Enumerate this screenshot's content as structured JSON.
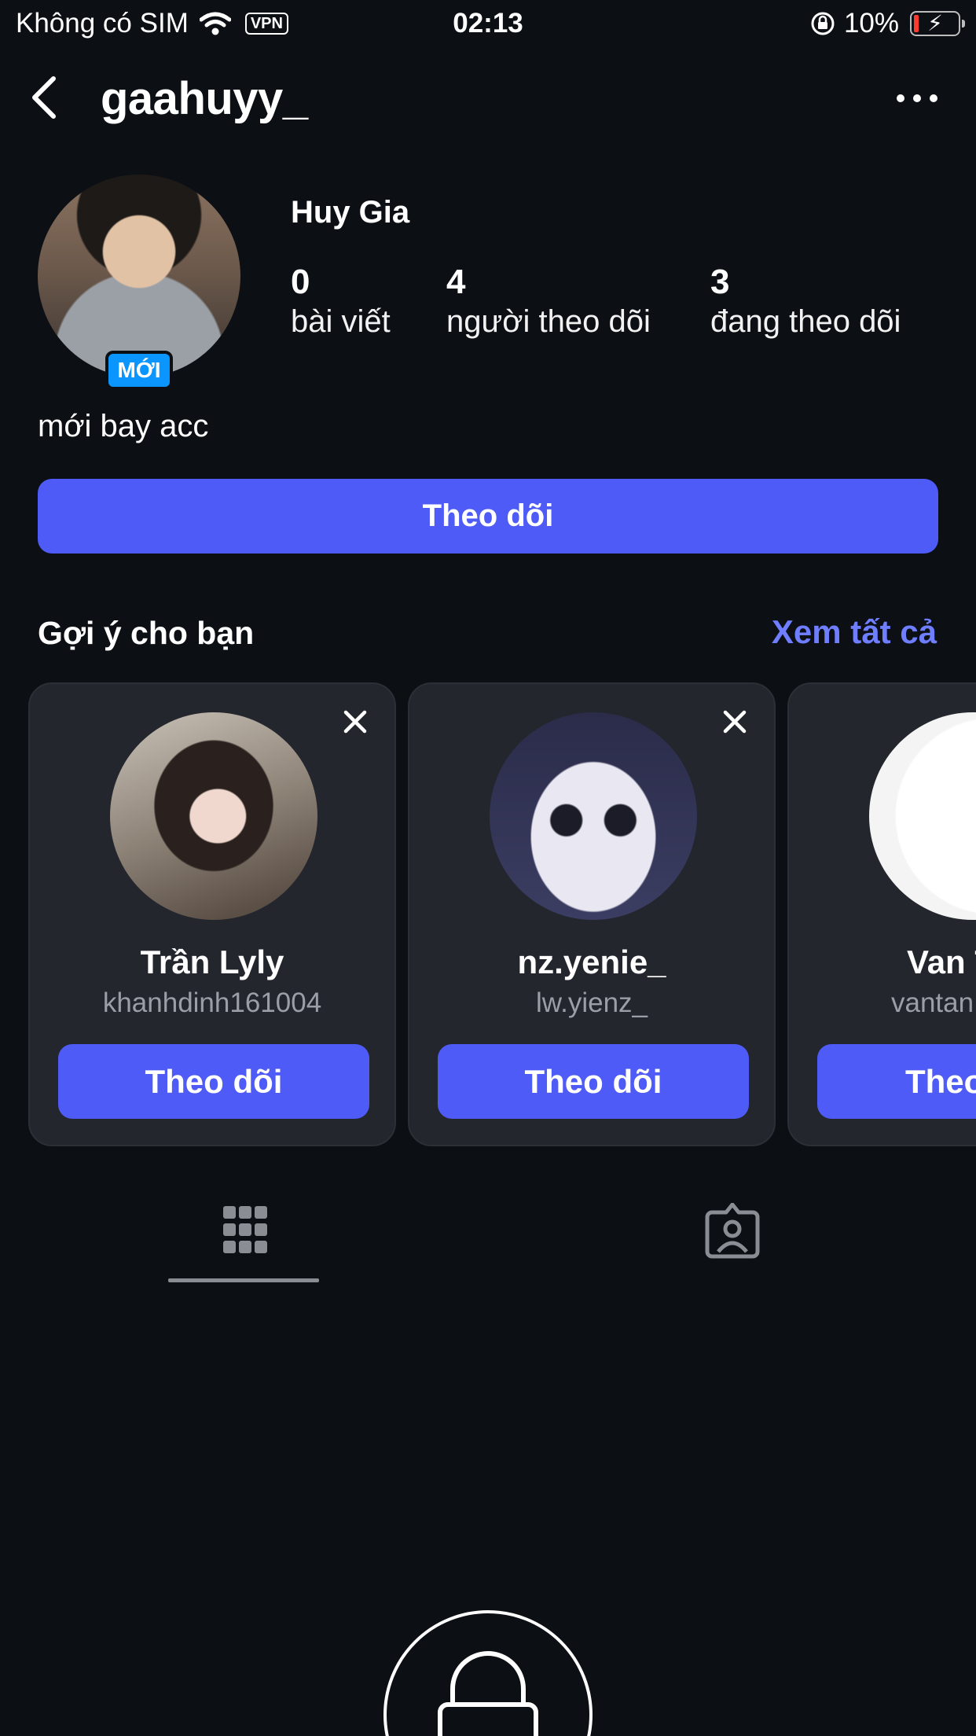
{
  "status_bar": {
    "carrier": "Không có SIM",
    "vpn": "VPN",
    "time": "02:13",
    "battery": "10%",
    "battery_color": "#ff3b30"
  },
  "header": {
    "username": "gaahuyy_",
    "back_icon": "chevron-left-icon",
    "more_icon": "ellipsis-icon"
  },
  "profile": {
    "display_name": "Huy Gia",
    "new_badge": "MỚI",
    "stats": [
      {
        "value": "0",
        "label": "bài viết"
      },
      {
        "value": "4",
        "label": "người theo dõi"
      },
      {
        "value": "3",
        "label": "đang theo dõi"
      }
    ],
    "bio": "mới bay acc",
    "follow_label": "Theo dõi"
  },
  "suggestions": {
    "title": "Gợi ý cho bạn",
    "see_all": "Xem tất cả",
    "cards": [
      {
        "name": "Trần Lyly",
        "handle": "khanhdinh161004",
        "follow_label": "Theo dõi"
      },
      {
        "name": "nz.yenie_",
        "handle": "lw.yienz_",
        "follow_label": "Theo dõi"
      },
      {
        "name": "Van T",
        "handle": "vantan",
        "follow_label": "Theo"
      }
    ]
  },
  "tabs": [
    {
      "icon": "grid-icon",
      "active": true
    },
    {
      "icon": "tagged-person-icon",
      "active": false
    }
  ],
  "colors": {
    "background": "#0c0f14",
    "accent": "#4f5bf6",
    "link": "#6f7dff",
    "card": "#23262d",
    "badge": "#0a95ff"
  }
}
